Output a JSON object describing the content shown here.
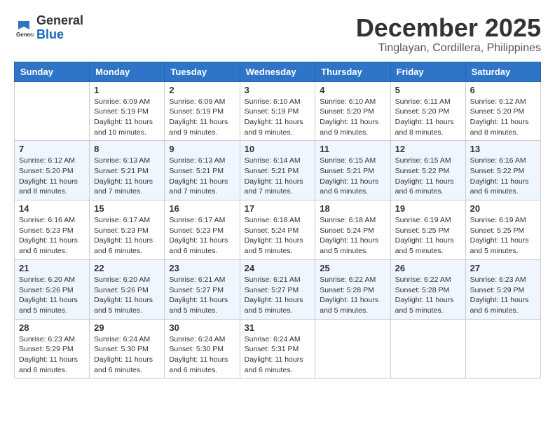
{
  "logo": {
    "text1": "General",
    "text2": "Blue"
  },
  "title": "December 2025",
  "location": "Tinglayan, Cordillera, Philippines",
  "days_of_week": [
    "Sunday",
    "Monday",
    "Tuesday",
    "Wednesday",
    "Thursday",
    "Friday",
    "Saturday"
  ],
  "weeks": [
    [
      {
        "day": "",
        "info": ""
      },
      {
        "day": "1",
        "info": "Sunrise: 6:09 AM\nSunset: 5:19 PM\nDaylight: 11 hours\nand 10 minutes."
      },
      {
        "day": "2",
        "info": "Sunrise: 6:09 AM\nSunset: 5:19 PM\nDaylight: 11 hours\nand 9 minutes."
      },
      {
        "day": "3",
        "info": "Sunrise: 6:10 AM\nSunset: 5:19 PM\nDaylight: 11 hours\nand 9 minutes."
      },
      {
        "day": "4",
        "info": "Sunrise: 6:10 AM\nSunset: 5:20 PM\nDaylight: 11 hours\nand 9 minutes."
      },
      {
        "day": "5",
        "info": "Sunrise: 6:11 AM\nSunset: 5:20 PM\nDaylight: 11 hours\nand 8 minutes."
      },
      {
        "day": "6",
        "info": "Sunrise: 6:12 AM\nSunset: 5:20 PM\nDaylight: 11 hours\nand 8 minutes."
      }
    ],
    [
      {
        "day": "7",
        "info": "Sunrise: 6:12 AM\nSunset: 5:20 PM\nDaylight: 11 hours\nand 8 minutes."
      },
      {
        "day": "8",
        "info": "Sunrise: 6:13 AM\nSunset: 5:21 PM\nDaylight: 11 hours\nand 7 minutes."
      },
      {
        "day": "9",
        "info": "Sunrise: 6:13 AM\nSunset: 5:21 PM\nDaylight: 11 hours\nand 7 minutes."
      },
      {
        "day": "10",
        "info": "Sunrise: 6:14 AM\nSunset: 5:21 PM\nDaylight: 11 hours\nand 7 minutes."
      },
      {
        "day": "11",
        "info": "Sunrise: 6:15 AM\nSunset: 5:21 PM\nDaylight: 11 hours\nand 6 minutes."
      },
      {
        "day": "12",
        "info": "Sunrise: 6:15 AM\nSunset: 5:22 PM\nDaylight: 11 hours\nand 6 minutes."
      },
      {
        "day": "13",
        "info": "Sunrise: 6:16 AM\nSunset: 5:22 PM\nDaylight: 11 hours\nand 6 minutes."
      }
    ],
    [
      {
        "day": "14",
        "info": "Sunrise: 6:16 AM\nSunset: 5:23 PM\nDaylight: 11 hours\nand 6 minutes."
      },
      {
        "day": "15",
        "info": "Sunrise: 6:17 AM\nSunset: 5:23 PM\nDaylight: 11 hours\nand 6 minutes."
      },
      {
        "day": "16",
        "info": "Sunrise: 6:17 AM\nSunset: 5:23 PM\nDaylight: 11 hours\nand 6 minutes."
      },
      {
        "day": "17",
        "info": "Sunrise: 6:18 AM\nSunset: 5:24 PM\nDaylight: 11 hours\nand 5 minutes."
      },
      {
        "day": "18",
        "info": "Sunrise: 6:18 AM\nSunset: 5:24 PM\nDaylight: 11 hours\nand 5 minutes."
      },
      {
        "day": "19",
        "info": "Sunrise: 6:19 AM\nSunset: 5:25 PM\nDaylight: 11 hours\nand 5 minutes."
      },
      {
        "day": "20",
        "info": "Sunrise: 6:19 AM\nSunset: 5:25 PM\nDaylight: 11 hours\nand 5 minutes."
      }
    ],
    [
      {
        "day": "21",
        "info": "Sunrise: 6:20 AM\nSunset: 5:26 PM\nDaylight: 11 hours\nand 5 minutes."
      },
      {
        "day": "22",
        "info": "Sunrise: 6:20 AM\nSunset: 5:26 PM\nDaylight: 11 hours\nand 5 minutes."
      },
      {
        "day": "23",
        "info": "Sunrise: 6:21 AM\nSunset: 5:27 PM\nDaylight: 11 hours\nand 5 minutes."
      },
      {
        "day": "24",
        "info": "Sunrise: 6:21 AM\nSunset: 5:27 PM\nDaylight: 11 hours\nand 5 minutes."
      },
      {
        "day": "25",
        "info": "Sunrise: 6:22 AM\nSunset: 5:28 PM\nDaylight: 11 hours\nand 5 minutes."
      },
      {
        "day": "26",
        "info": "Sunrise: 6:22 AM\nSunset: 5:28 PM\nDaylight: 11 hours\nand 5 minutes."
      },
      {
        "day": "27",
        "info": "Sunrise: 6:23 AM\nSunset: 5:29 PM\nDaylight: 11 hours\nand 6 minutes."
      }
    ],
    [
      {
        "day": "28",
        "info": "Sunrise: 6:23 AM\nSunset: 5:29 PM\nDaylight: 11 hours\nand 6 minutes."
      },
      {
        "day": "29",
        "info": "Sunrise: 6:24 AM\nSunset: 5:30 PM\nDaylight: 11 hours\nand 6 minutes."
      },
      {
        "day": "30",
        "info": "Sunrise: 6:24 AM\nSunset: 5:30 PM\nDaylight: 11 hours\nand 6 minutes."
      },
      {
        "day": "31",
        "info": "Sunrise: 6:24 AM\nSunset: 5:31 PM\nDaylight: 11 hours\nand 6 minutes."
      },
      {
        "day": "",
        "info": ""
      },
      {
        "day": "",
        "info": ""
      },
      {
        "day": "",
        "info": ""
      }
    ]
  ]
}
